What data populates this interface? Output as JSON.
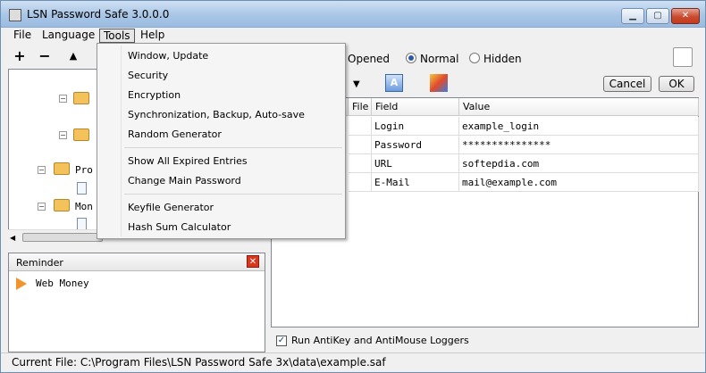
{
  "window": {
    "title": "LSN Password Safe 3.0.0.0"
  },
  "menubar": {
    "file": "File",
    "language": "Language",
    "tools": "Tools",
    "help": "Help"
  },
  "tools_menu": {
    "items": [
      "Window, Update",
      "Security",
      "Encryption",
      "Synchronization, Backup, Auto-save",
      "Random Generator",
      "Show All Expired Entries",
      "Change Main Password",
      "Keyfile Generator",
      "Hash Sum Calculator"
    ]
  },
  "tree": {
    "nodes": [
      {
        "label": "Pro"
      },
      {
        "label": "Mon"
      }
    ]
  },
  "reminder": {
    "title": "Reminder",
    "items": [
      "Web Money"
    ]
  },
  "view_options": {
    "opened": "Opened",
    "normal": "Normal",
    "hidden": "Hidden",
    "selected": "Normal"
  },
  "buttons": {
    "cancel": "Cancel",
    "ok": "OK"
  },
  "grid": {
    "columns": [
      "File",
      "Field",
      "Value"
    ],
    "rows": [
      {
        "field": "Login",
        "value": "example_login"
      },
      {
        "field": "Password",
        "value": "***************"
      },
      {
        "field": "URL",
        "value": "softepdia.com"
      },
      {
        "field": "E-Mail",
        "value": "mail@example.com"
      }
    ]
  },
  "antikey": {
    "label": "Run AntiKey and AntiMouse Loggers",
    "checked": true
  },
  "status": {
    "current_file": "Current File: C:\\Program Files\\LSN Password Safe 3x\\data\\example.saf"
  }
}
